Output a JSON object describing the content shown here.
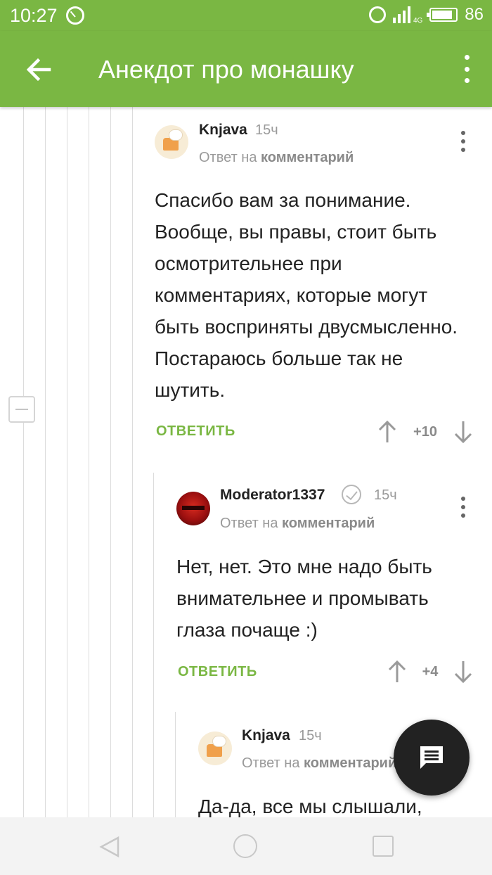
{
  "status": {
    "time": "10:27",
    "network": "4G",
    "battery": "86"
  },
  "appbar": {
    "title": "Анекдот про монашку"
  },
  "comments": [
    {
      "author": "Knjava",
      "time": "15ч",
      "reply_prefix": "Ответ на",
      "reply_target": "комментарий",
      "text": "Спасибо вам за понимание. Вообще, вы правы, стоит быть осмотрительнее при комментариях, которые могут быть восприняты двусмысленно. Постараюсь больше так не шутить.",
      "reply_label": "ОТВЕТИТЬ",
      "score": "+10"
    },
    {
      "author": "Moderator1337",
      "time": "15ч",
      "reply_prefix": "Ответ на",
      "reply_target": "комментарий",
      "text": "Нет, нет. Это мне надо быть внимательнее и промывать глаза почаще :)",
      "reply_label": "ОТВЕТИТЬ",
      "score": "+4"
    },
    {
      "author": "Knjava",
      "time": "15ч",
      "reply_prefix": "Ответ на",
      "reply_target": "комментарий",
      "text": "Да-да, все мы слышали,"
    }
  ],
  "colors": {
    "brand": "#7ab743",
    "fab": "#222222"
  },
  "icons": {
    "back": "arrow-left-icon",
    "menu": "more-vertical-icon",
    "verified": "check-circle-icon",
    "vote_up": "arrow-up-icon",
    "vote_down": "arrow-down-icon",
    "fab": "message-icon"
  }
}
